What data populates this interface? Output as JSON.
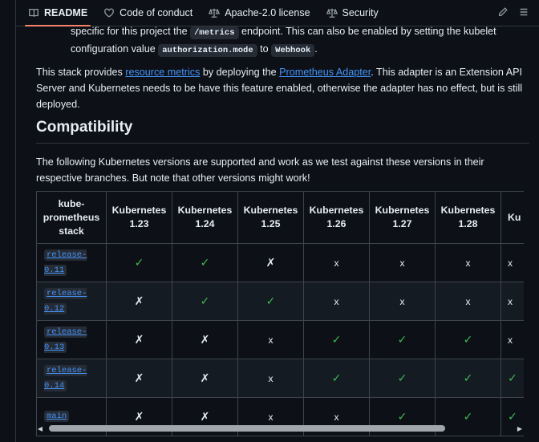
{
  "tabs": [
    {
      "label": "README",
      "icon": "book-icon"
    },
    {
      "label": "Code of conduct",
      "icon": "heart-icon"
    },
    {
      "label": "Apache-2.0 license",
      "icon": "scale-icon"
    },
    {
      "label": "Security",
      "icon": "law-icon"
    }
  ],
  "colors": {
    "accent": "#f78166",
    "link": "#4493f8",
    "check": "#3fb950",
    "bg": "#0d1117"
  },
  "list_item": {
    "text1": "specific for this project the",
    "code1": "/metrics",
    "text2": "endpoint. This can also be enabled by setting the kubelet configuration value",
    "code2": "authorization.mode",
    "text3": "to",
    "code3": "Webhook",
    "text4": "."
  },
  "para": {
    "t1": "This stack provides",
    "link1": "resource metrics",
    "t2": "by deploying the",
    "link2": "Prometheus Adapter",
    "t3": ". This adapter is an Extension API Server and Kubernetes needs to be have this feature enabled, otherwise the adapter has no effect, but is still deployed."
  },
  "heading": "Compatibility",
  "compat_para": "The following Kubernetes versions are supported and work as we test against these versions in their respective branches. But note that other versions might work!",
  "table": {
    "headers": [
      "kube-prometheus stack",
      "Kubernetes 1.23",
      "Kubernetes 1.24",
      "Kubernetes 1.25",
      "Kubernetes 1.26",
      "Kubernetes 1.27",
      "Kubernetes 1.28",
      "Ku"
    ],
    "rows": [
      {
        "release": "release-0.11",
        "cells": [
          "✓",
          "✓",
          "✗",
          "x",
          "x",
          "x",
          "x"
        ]
      },
      {
        "release": "release-0.12",
        "cells": [
          "✗",
          "✓",
          "✓",
          "x",
          "x",
          "x",
          "x"
        ]
      },
      {
        "release": "release-0.13",
        "cells": [
          "✗",
          "✗",
          "x",
          "✓",
          "✓",
          "✓",
          "x"
        ]
      },
      {
        "release": "release-0.14",
        "cells": [
          "✗",
          "✗",
          "x",
          "✓",
          "✓",
          "✓",
          "✓"
        ]
      },
      {
        "release": "main",
        "cells": [
          "✗",
          "✗",
          "x",
          "x",
          "✓",
          "✓",
          "✓"
        ]
      }
    ]
  }
}
